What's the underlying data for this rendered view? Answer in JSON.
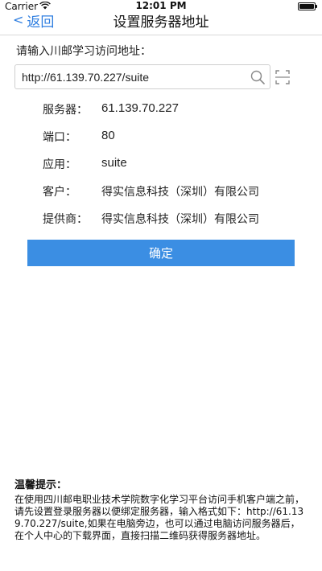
{
  "status_bar": {
    "carrier": "Carrier",
    "time": "12:01 PM"
  },
  "nav": {
    "back_label": "返回",
    "back_chevron": "<",
    "title": "设置服务器地址",
    "accent_color": "#2d7de0"
  },
  "form": {
    "prompt": "请输入川邮学习访问地址：",
    "url_value": "http://61.139.70.227/suite",
    "search_icon": "search-icon",
    "scan_icon": "scan-icon"
  },
  "info": [
    {
      "label": "服务器：",
      "value": "61.139.70.227"
    },
    {
      "label": "端口：",
      "value": "80"
    },
    {
      "label": "应用：",
      "value": "suite"
    },
    {
      "label": "客户：",
      "value": "得实信息科技（深圳）有限公司"
    },
    {
      "label": "提供商：",
      "value": "得实信息科技（深圳）有限公司"
    }
  ],
  "confirm": {
    "label": "确定",
    "color": "#3b8ee3"
  },
  "tips": {
    "title": "温馨提示：",
    "body": "在使用四川邮电职业技术学院数字化学习平台访问手机客户端之前，请先设置登录服务器以便绑定服务器，输入格式如下：http://61.139.70.227/suite,如果在电脑旁边，也可以通过电脑访问服务器后，在个人中心的下载界面，直接扫描二维码获得服务器地址。"
  }
}
